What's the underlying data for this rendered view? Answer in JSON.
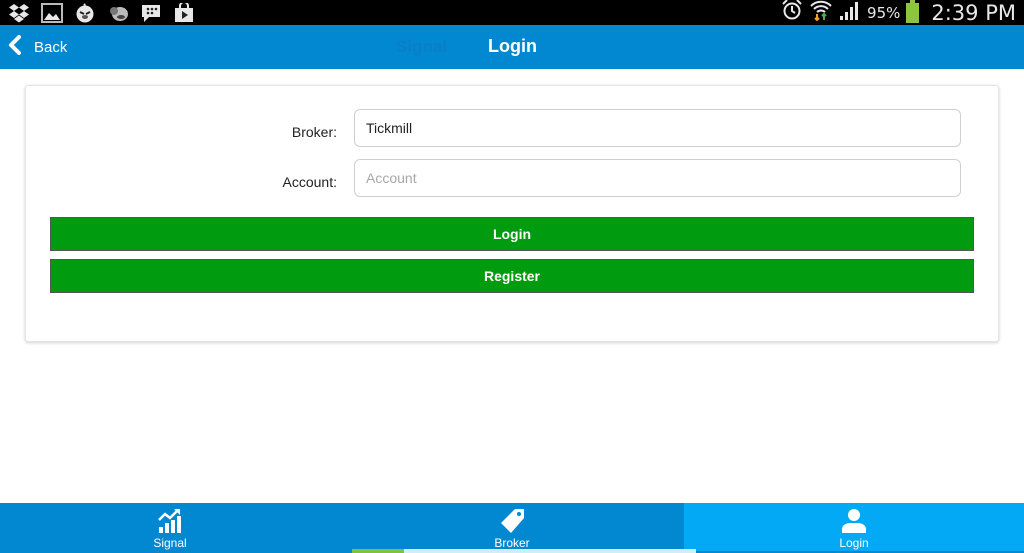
{
  "status_bar": {
    "left_icons": [
      "dropbox-icon",
      "gallery-icon",
      "angry-bird-icon",
      "game-icon",
      "bbm-icon",
      "play-store-icon"
    ],
    "right_icons": [
      "alarm-icon",
      "wifi-icon",
      "signal-icon",
      "battery-icon"
    ],
    "battery_percent": "95%",
    "time": "2:39 PM",
    "battery_color": "#8cc63f"
  },
  "navbar": {
    "back_label": "Back",
    "faded_title": "Signal",
    "title": "Login",
    "color": "#0288d1"
  },
  "form": {
    "broker_label": "Broker:",
    "broker_value": "Tickmill",
    "account_label": "Account:",
    "account_placeholder": "Account",
    "account_value": "",
    "login_button": "Login",
    "register_button": "Register",
    "button_color": "#009b0e"
  },
  "tabbar": {
    "tabs": [
      {
        "label": "Signal",
        "icon": "chart-trend-icon",
        "active": false
      },
      {
        "label": "Broker",
        "icon": "tag-icon",
        "active": false
      },
      {
        "label": "Login",
        "icon": "user-icon",
        "active": true
      }
    ],
    "active_color": "#03a9f4",
    "progress_fraction": 0.15
  }
}
